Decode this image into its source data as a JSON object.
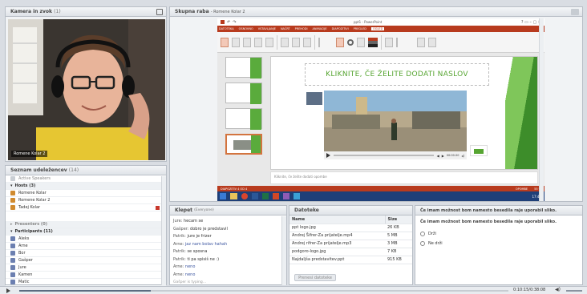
{
  "camera": {
    "title": "Kamera in zvok",
    "count": "(1)",
    "name_label": "Romene Kolar 2"
  },
  "share": {
    "title": "Skupna raba",
    "subtitle": "- Romene Kolar 2"
  },
  "ppt": {
    "window_title": "ppt1 - PowerPoint",
    "ribbon_tabs": [
      "DATOTEKA",
      "OSNOVNO",
      "VSTAVLJANJE",
      "NAČRT",
      "PREHODI",
      "ANIMACIJE",
      "DIAPOZITIVI",
      "PREGLED",
      "OGLED"
    ],
    "active_tab": "OGLED",
    "slide_title": "KLIKNITE, ČE ŽELITE DODATI NASLOV",
    "notes": "Kliknite, če želite dodati opombe",
    "media_time": "00:00.00",
    "status_left": "DIAPOZITIV 4 OD 4",
    "status_right": "OPOMBE",
    "status_zoom": "55 %",
    "clock": "17:45"
  },
  "attendees": {
    "title": "Seznam udeležencev",
    "count": "(14)",
    "active": "Active Speakers",
    "hosts": "Hosts (3)",
    "host_list": [
      "Romene Kolar",
      "Romene Kolar 2",
      "Tadej Kolar"
    ],
    "presenters": "Presenters (0)",
    "participants": "Participants (11)",
    "participant_list": [
      "Aleks",
      "Arne",
      "Bor",
      "Gašper",
      "Jure",
      "Kamen",
      "Matic"
    ]
  },
  "chat": {
    "title": "Klepet",
    "scope": "(Everyone)",
    "messages": [
      {
        "who": "Jure:",
        "text": "hecam se"
      },
      {
        "who": "Gašper:",
        "text": "dobro je predstavil"
      },
      {
        "who": "Patrik:",
        "text": "jure je frizer"
      },
      {
        "who": "Arne:",
        "text": "jaz nam bolav hahah"
      },
      {
        "who": "Patrik:",
        "text": "se sposna"
      },
      {
        "who": "Patrik:",
        "text": "ti pa spisiš ne :)"
      },
      {
        "who": "Arne:",
        "text": "neno"
      },
      {
        "who": "Arne:",
        "text": "neno"
      }
    ],
    "typing": "Gašper is typing..."
  },
  "files": {
    "title": "Datoteke",
    "headers": [
      "Name",
      "Size"
    ],
    "rows": [
      [
        "ppt logo.jpg",
        "26 KB"
      ],
      [
        "Andrej Šifrer-Za prijatelje.mp4",
        "5 MB"
      ],
      [
        "Andrej rifrer-Za prijatelje.mp3",
        "3 MB"
      ],
      [
        "podgoro-logo.jpg",
        "7 KB"
      ],
      [
        "Najdaljša predstavitev.ppt",
        "915 KB"
      ]
    ],
    "download_label": "Prenesi datoteke"
  },
  "poll": {
    "header": "Če imam možnost bom namesto besedila raje uporabil sliko.",
    "question": "Če imam možnost bom namesto besedila raje uporabil sliko.",
    "options": [
      "Drži",
      "Ne drži"
    ]
  },
  "player": {
    "time": "0:10:15/0:38:08"
  }
}
